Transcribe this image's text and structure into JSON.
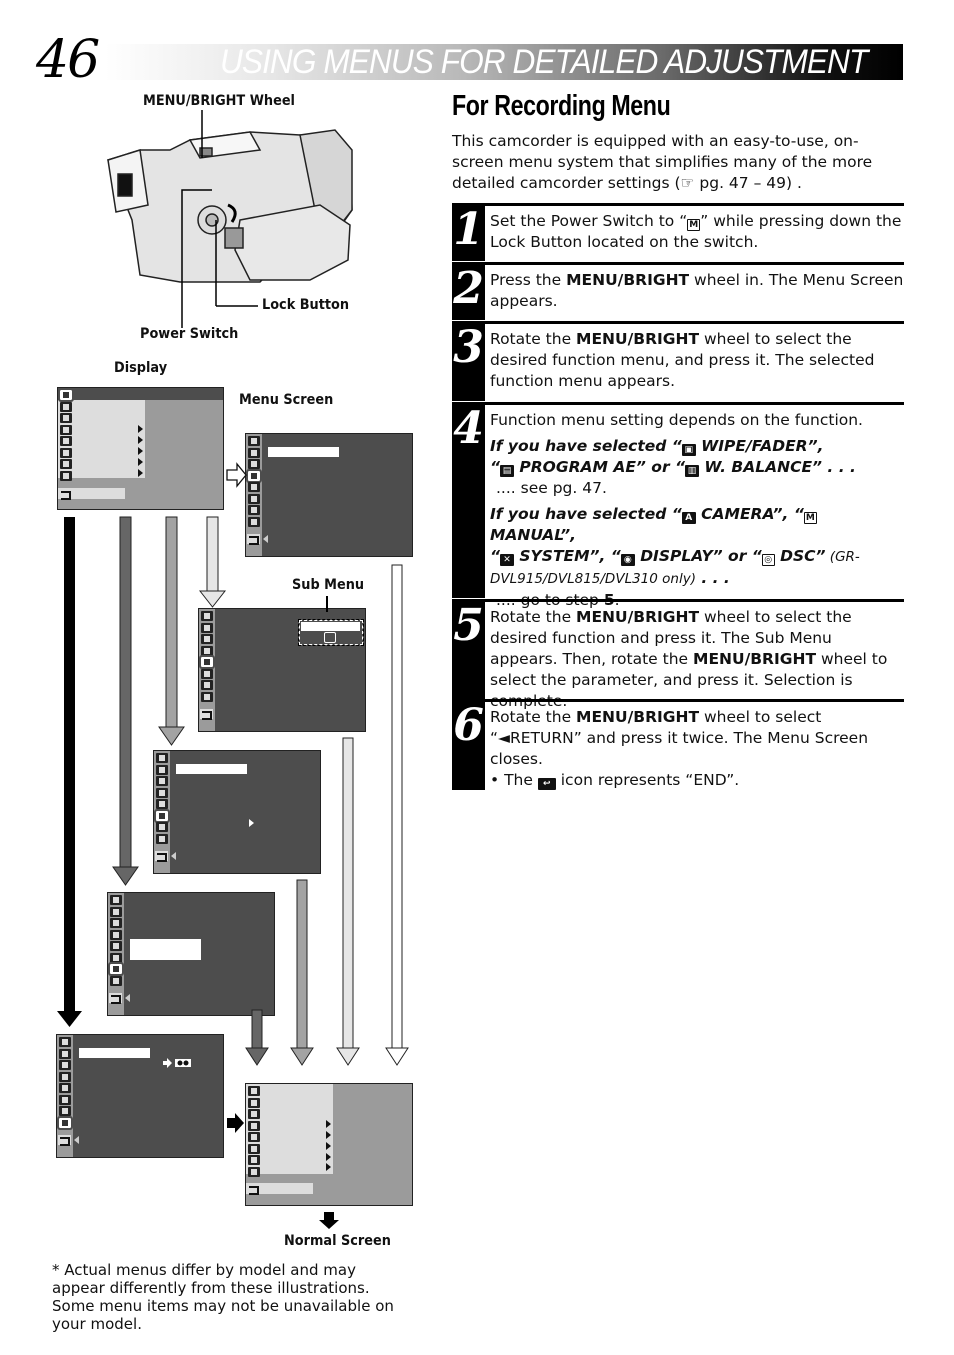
{
  "header": {
    "page_number": "46",
    "title": "USING MENUS FOR DETAILED ADJUSTMENT"
  },
  "illustration": {
    "labels": {
      "menu_bright_wheel": "MENU/BRIGHT Wheel",
      "lock_button": "Lock Button",
      "power_switch": "Power Switch",
      "display": "Display",
      "menu_screen": "Menu Screen",
      "sub_menu": "Sub Menu",
      "normal_screen": "Normal Screen"
    },
    "menu_icons": [
      "wipe-fader-icon",
      "program-ae-icon",
      "white-balance-icon",
      "camera-icon",
      "manual-icon",
      "system-icon",
      "display-icon",
      "dsc-icon"
    ],
    "return_icon": "return-icon"
  },
  "section": {
    "title": "For Recording Menu",
    "intro_before": "This camcorder is equipped with an easy-to-use, on-screen menu system that simplifies many of the more detailed camcorder settings (",
    "intro_ref_icon": "☞",
    "intro_after": " pg. 47 – 49) ."
  },
  "steps": [
    {
      "number": "1",
      "text_a": "Set the Power Switch to “",
      "glyph": "M",
      "text_b": "” while pressing down the Lock Button located on the switch."
    },
    {
      "number": "2",
      "text_a": "Press the ",
      "bold": "MENU/BRIGHT",
      "text_b": " wheel in. The Menu Screen appears."
    },
    {
      "number": "3",
      "text_a": "Rotate the ",
      "bold": "MENU/BRIGHT",
      "text_b": " wheel to select the desired function menu, and press it. The selected function menu appears."
    },
    {
      "number": "4",
      "line1": "Function menu setting depends on the function.",
      "case1": {
        "prefix": "If you have selected “",
        "items": [
          "WIPE/FADER”,",
          "“",
          "PROGRAM AE” or “",
          "W. BALANCE” . . ."
        ],
        "result": ".... see pg. 47."
      },
      "case2": {
        "prefix": "If you have selected “",
        "camera": "CAMERA”, “",
        "manual": "MANUAL”,",
        "open": "“",
        "system": "SYSTEM”, “",
        "display": "DISPLAY” or “",
        "dsc": "DSC”",
        "models": " (GR-DVL915/DVL815/DVL310 only)",
        "dots": " . . .",
        "result_a": ".... go to step ",
        "result_b": "5",
        "result_c": "."
      }
    },
    {
      "number": "5",
      "text_a": "Rotate the ",
      "bold1": "MENU/BRIGHT",
      "text_b": " wheel to select the desired function and press it. The Sub Menu appears. Then, rotate the ",
      "bold2": "MENU/BRIGHT",
      "text_c": " wheel to select the parameter, and press it. Selection is complete."
    },
    {
      "number": "6",
      "text_a": "Rotate the ",
      "bold": "MENU/BRIGHT",
      "text_b": " wheel to select “◄RETURN” and press it twice. The Menu Screen closes.",
      "bullet_a": "• The ",
      "bullet_b": " icon represents “END”."
    }
  ],
  "footnote": "* Actual menus differ by model and may appear differently from these illustrations. Some menu items may not be unavailable on your model."
}
